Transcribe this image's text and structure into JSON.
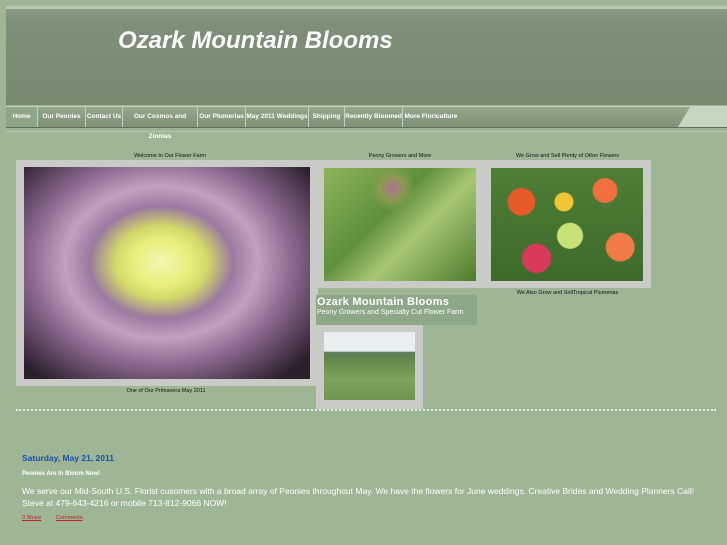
{
  "header": {
    "title": "Ozark Mountain Blooms"
  },
  "nav": [
    {
      "label": "Home"
    },
    {
      "label": "Our Peonies"
    },
    {
      "label": "Contact Us"
    },
    {
      "label": "Our Cosmos and Zinnias"
    },
    {
      "label": "Our Plumerias"
    },
    {
      "label": "May 2011 Weddings"
    },
    {
      "label": "Shipping"
    },
    {
      "label": "Recently Bloomed"
    },
    {
      "label": "More Floriculture"
    }
  ],
  "gallery": {
    "caption_welcome": "Welcome to Our Flower Farm",
    "caption_peony_growers": "Peony Growers and More",
    "caption_other_flowers": "We Grow and Sell Plenty of Other Flowers",
    "caption_plumerias": "We Also Grow and SellTropical Plumerias",
    "caption_primavera": "One of Our Primavera May 2011"
  },
  "farm": {
    "name": "Ozark Mountain Blooms",
    "tagline": "Peony Growers and Specialty Cut Flower Farm"
  },
  "post": {
    "date": "Saturday, May 21, 2011",
    "title": "Peonies Are In Bloom Now!",
    "body": "We serve our Mid-South U.S. Florist cusomers with a broad array of Peonies throughout May. We have the flowers for June weddings. Creative Brides and Wedding Planners Call! Steve at 479-643-4216 or mobile 713-812-9066 NOW!",
    "share_label": "0 Share",
    "comments_label": "Comments"
  }
}
